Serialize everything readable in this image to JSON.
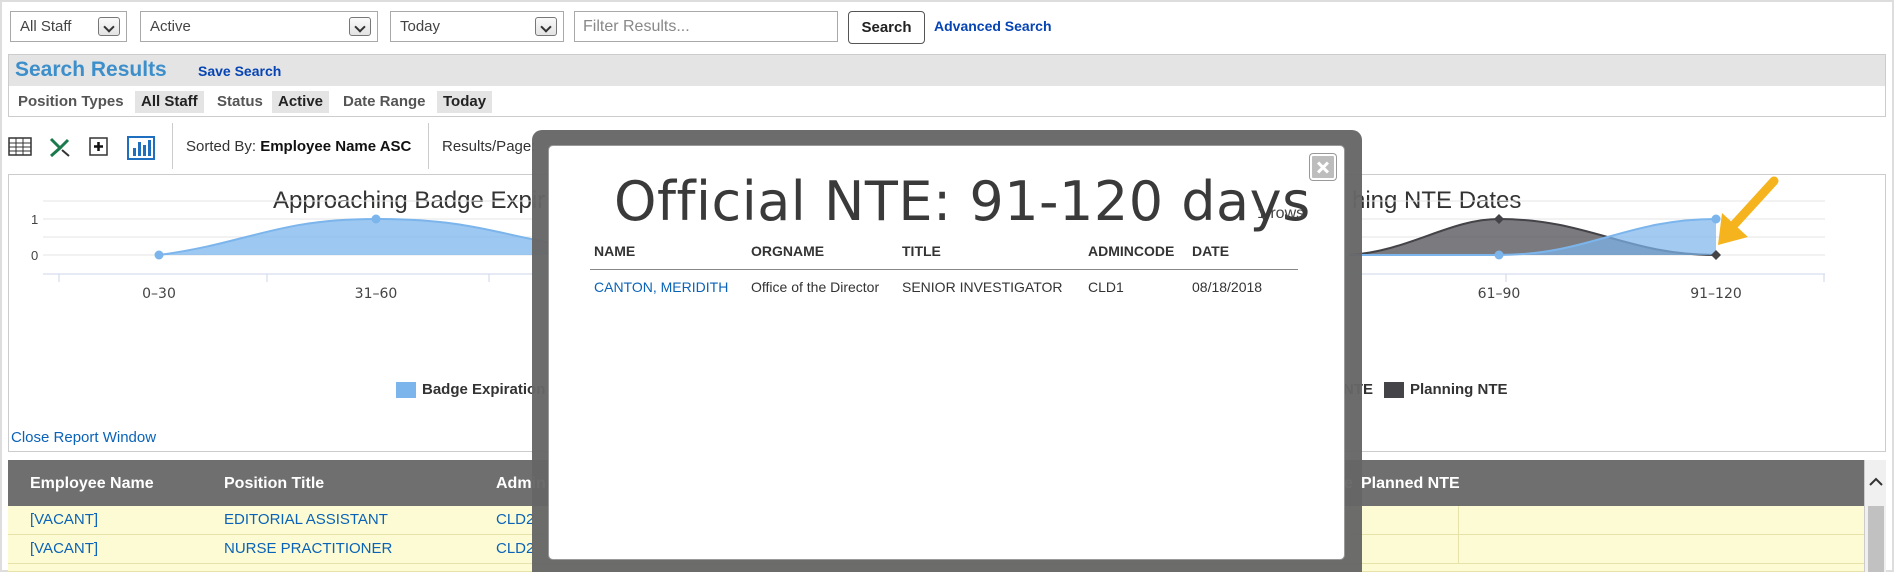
{
  "search_bar": {
    "position_types_select": "All Staff",
    "status_select": "Active",
    "date_select": "Today",
    "filter_placeholder": "Filter Results...",
    "search_button": "Search",
    "advanced_search_link": "Advanced Search"
  },
  "results_panel": {
    "title": "Search Results",
    "save_search": "Save Search",
    "criteria": [
      {
        "label": "Position Types",
        "value": "All Staff"
      },
      {
        "label": "Status",
        "value": "Active"
      },
      {
        "label": "Date Range",
        "value": "Today"
      }
    ]
  },
  "toolbar": {
    "icons": [
      "grid-view-icon",
      "excel-export-icon",
      "add-column-icon",
      "chart-report-icon"
    ],
    "sorted_by_label": "Sorted By:",
    "sorted_by_value": "Employee Name ASC",
    "results_page_label": "Results/Page:"
  },
  "chart_data": [
    {
      "type": "area",
      "title": "Approaching Badge Expir",
      "categories": [
        "0-30",
        "31-60"
      ],
      "series": [
        {
          "name": "Badge Expiration",
          "values": [
            0,
            1
          ],
          "color": "#7cb5ec"
        }
      ],
      "ylim": [
        0,
        1
      ],
      "yticks": [
        "1",
        "0"
      ],
      "x_tick_labels": [
        "0–30",
        "31–60"
      ],
      "legend_labels": [
        "Badge Expiration"
      ]
    },
    {
      "type": "area",
      "title": "hing NTE Dates",
      "categories": [
        "61-90",
        "91-120"
      ],
      "series": [
        {
          "name": "Official NTE",
          "values": [
            0,
            1
          ],
          "color": "#7cb5ec"
        },
        {
          "name": "Planning NTE",
          "values": [
            1,
            0
          ],
          "color": "#434348"
        }
      ],
      "ylim": [
        0,
        1
      ],
      "x_tick_labels": [
        "61–90",
        "91–120"
      ],
      "legend_labels": [
        "NTE",
        "Planning NTE"
      ]
    }
  ],
  "close_report": "Close Report Window",
  "table": {
    "headers": [
      "Employee Name",
      "Position Title",
      "Admin",
      "e",
      "Planned NTE"
    ],
    "rows": [
      {
        "name": "[VACANT]",
        "title": "EDITORIAL ASSISTANT",
        "admin": "CLD2"
      },
      {
        "name": "[VACANT]",
        "title": "NURSE PRACTITIONER",
        "admin": "CLD2"
      }
    ]
  },
  "modal": {
    "title": "Official NTE: 91-120 days",
    "row_count": "1 rows",
    "headers": [
      "NAME",
      "ORGNAME",
      "TITLE",
      "ADMINCODE",
      "DATE"
    ],
    "rows": [
      {
        "name": "CANTON, MERIDITH",
        "orgname": "Office of the Director",
        "title": "SENIOR INVESTIGATOR",
        "admincode": "CLD1",
        "date": "08/18/2018"
      }
    ]
  },
  "colors": {
    "accent": "#3d8fcb",
    "link": "#0a63b8",
    "series_blue": "#7cb5ec",
    "series_dark": "#434348",
    "table_header": "#6f6f6f",
    "row_bg": "#fdfbd3",
    "arrow": "#f5b41e"
  }
}
